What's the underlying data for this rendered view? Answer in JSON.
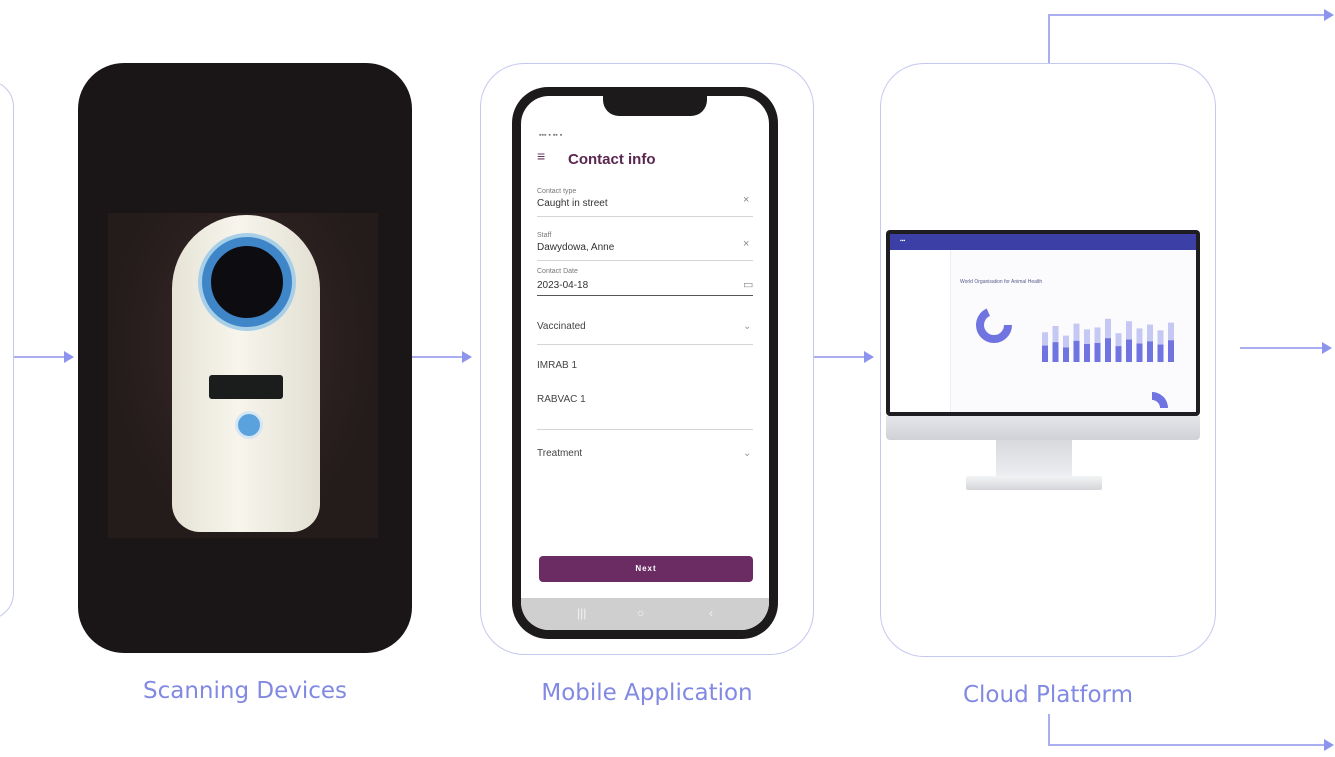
{
  "stages": [
    {
      "caption": "Scanning Devices"
    },
    {
      "caption": "Mobile Application"
    },
    {
      "caption": "Cloud Platform"
    }
  ],
  "phone": {
    "title": "Contact info",
    "fields": [
      {
        "label": "Contact type",
        "value": "Caught in street"
      },
      {
        "label": "Staff",
        "value": "Dawydowa, Anne"
      },
      {
        "label": "Contact Date",
        "value": "2023-04-18"
      }
    ],
    "sections": [
      "Vaccinated",
      "Treatment"
    ],
    "vaccines": [
      "IMRAB 1",
      "RABVAC 1"
    ],
    "next_label": "Next"
  },
  "dashboard": {
    "title": "World Organisation for Animal Health",
    "chart_data": {
      "type": "bar",
      "values": [
        0.62,
        0.75,
        0.55,
        0.8,
        0.68,
        0.72,
        0.9,
        0.6,
        0.85,
        0.7,
        0.78,
        0.66,
        0.82
      ],
      "ylim": [
        0,
        1
      ]
    },
    "accent_color": "#6f74e0"
  },
  "colors": {
    "connector": "#a8aeef",
    "caption": "#8189e3",
    "card_border": "#c3c8ee",
    "app_primary": "#6b2c63"
  }
}
